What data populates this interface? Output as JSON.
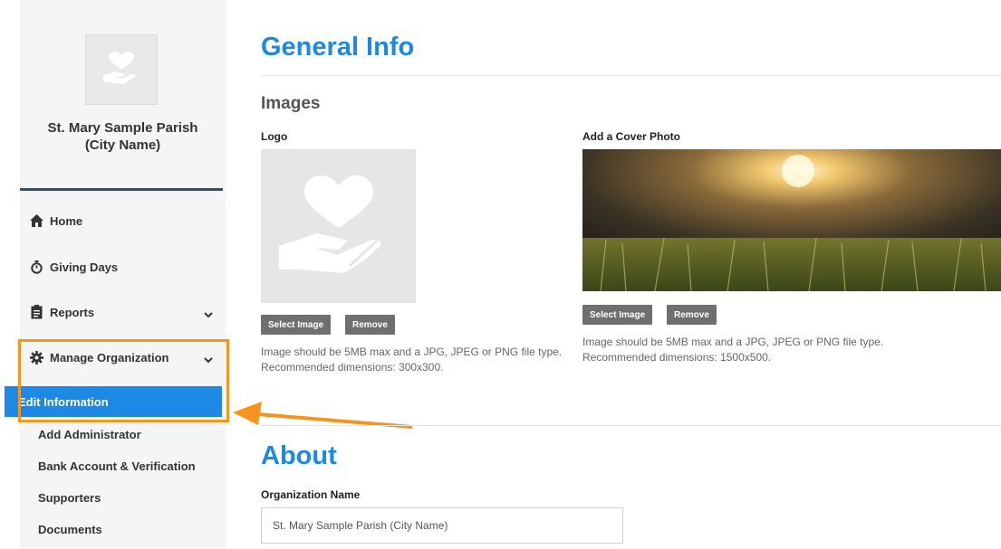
{
  "sidebar": {
    "org_name": "St. Mary Sample Parish\n(City Name)",
    "items": [
      {
        "label": "Home",
        "icon": "home-icon"
      },
      {
        "label": "Giving Days",
        "icon": "stopwatch-icon"
      },
      {
        "label": "Reports",
        "icon": "clipboard-icon"
      },
      {
        "label": "Manage Organization",
        "icon": "gear-icon"
      }
    ],
    "sub_items": [
      {
        "label": "Edit Information"
      },
      {
        "label": "Add Administrator"
      },
      {
        "label": "Bank Account & Verification"
      },
      {
        "label": "Supporters"
      },
      {
        "label": "Documents"
      }
    ]
  },
  "main": {
    "title": "General Info",
    "images_heading": "Images",
    "logo": {
      "label": "Logo",
      "select_label": "Select Image",
      "remove_label": "Remove",
      "help": "Image should be 5MB max and a JPG, JPEG or PNG file type.\nRecommended dimensions: 300x300."
    },
    "cover": {
      "label": "Add a Cover Photo",
      "select_label": "Select Image",
      "remove_label": "Remove",
      "help": "Image should be 5MB max and a JPG, JPEG or PNG file type.\nRecommended dimensions: 1500x500."
    },
    "about_title": "About",
    "org_name_label": "Organization Name",
    "org_name_value": "St. Mary Sample Parish (City Name)"
  },
  "colors": {
    "accent": "#1e88e5",
    "highlight": "#f7941d",
    "sidebar_bg": "#f5f5f5",
    "button": "#6f6f6f"
  }
}
